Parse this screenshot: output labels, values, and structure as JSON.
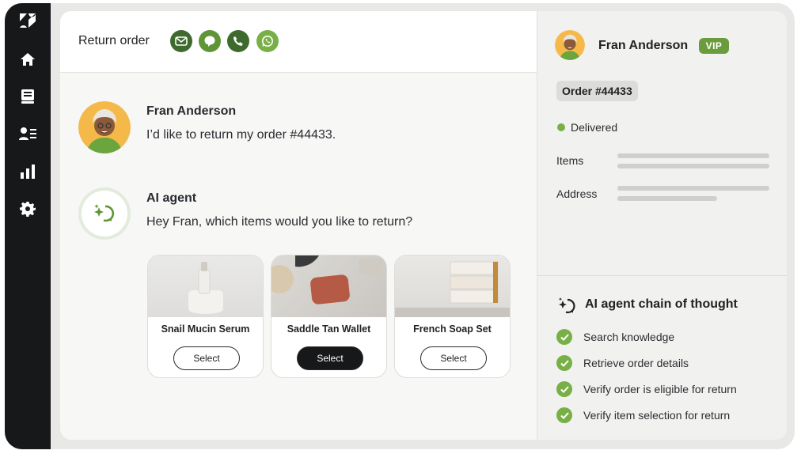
{
  "conversation": {
    "title": "Return order",
    "channels": [
      {
        "name": "email-icon",
        "color": "#3f6a2e"
      },
      {
        "name": "chat-icon",
        "color": "#5e9535"
      },
      {
        "name": "phone-icon",
        "color": "#3f6a2e"
      },
      {
        "name": "whatsapp-icon",
        "color": "#78b047"
      }
    ],
    "messages": [
      {
        "sender": "Fran Anderson",
        "text": "I’d like to return my order #44433."
      },
      {
        "sender": "AI agent",
        "text": "Hey Fran, which items would you like to return?"
      }
    ],
    "products": [
      {
        "name": "Snail Mucin Serum",
        "button": "Select",
        "selected": false
      },
      {
        "name": "Saddle Tan Wallet",
        "button": "Select",
        "selected": true
      },
      {
        "name": "French Soap Set",
        "button": "Select",
        "selected": false
      }
    ]
  },
  "customer": {
    "name": "Fran Anderson",
    "badge": "VIP",
    "order": "Order #44433",
    "status": "Delivered",
    "fields": [
      {
        "label": "Items"
      },
      {
        "label": "Address"
      }
    ]
  },
  "chain_of_thought": {
    "title": "AI agent chain of thought",
    "steps": [
      {
        "label": "Search knowledge"
      },
      {
        "label": "Retrieve order details"
      },
      {
        "label": "Verify order is eligible for return"
      },
      {
        "label": "Verify item selection for return"
      }
    ]
  },
  "colors": {
    "accent_green": "#78b047",
    "dark_green": "#3f6a2e",
    "rail": "#17181a"
  }
}
